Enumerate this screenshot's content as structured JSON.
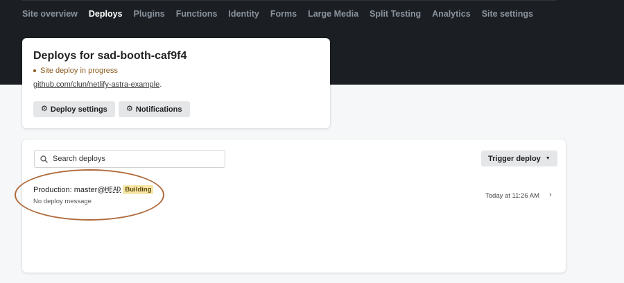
{
  "nav": {
    "items": [
      {
        "label": "Site overview",
        "active": false
      },
      {
        "label": "Deploys",
        "active": true
      },
      {
        "label": "Plugins",
        "active": false
      },
      {
        "label": "Functions",
        "active": false
      },
      {
        "label": "Identity",
        "active": false
      },
      {
        "label": "Forms",
        "active": false
      },
      {
        "label": "Large Media",
        "active": false
      },
      {
        "label": "Split Testing",
        "active": false
      },
      {
        "label": "Analytics",
        "active": false
      },
      {
        "label": "Site settings",
        "active": false
      }
    ]
  },
  "site": {
    "title": "Deploys for sad-booth-caf9f4",
    "status": "Site deploy in progress",
    "repo_link": "github.com/clun/netlify-astra-example",
    "repo_suffix": ".",
    "deploy_settings_label": "Deploy settings",
    "notifications_label": "Notifications",
    "gear_icon": "gear-icon"
  },
  "deploys": {
    "search_placeholder": "Search deploys",
    "trigger_label": "Trigger deploy",
    "rows": [
      {
        "prefix": "Production: master@",
        "ref": "HEAD",
        "badge": "Building",
        "message": "No deploy message",
        "time": "Today at 11:26 AM"
      }
    ]
  },
  "colors": {
    "header_bg": "#1b1f24",
    "status": "#8a5a1e",
    "badge_bg": "#f6e7a8",
    "annotation": "#b06a3b"
  }
}
